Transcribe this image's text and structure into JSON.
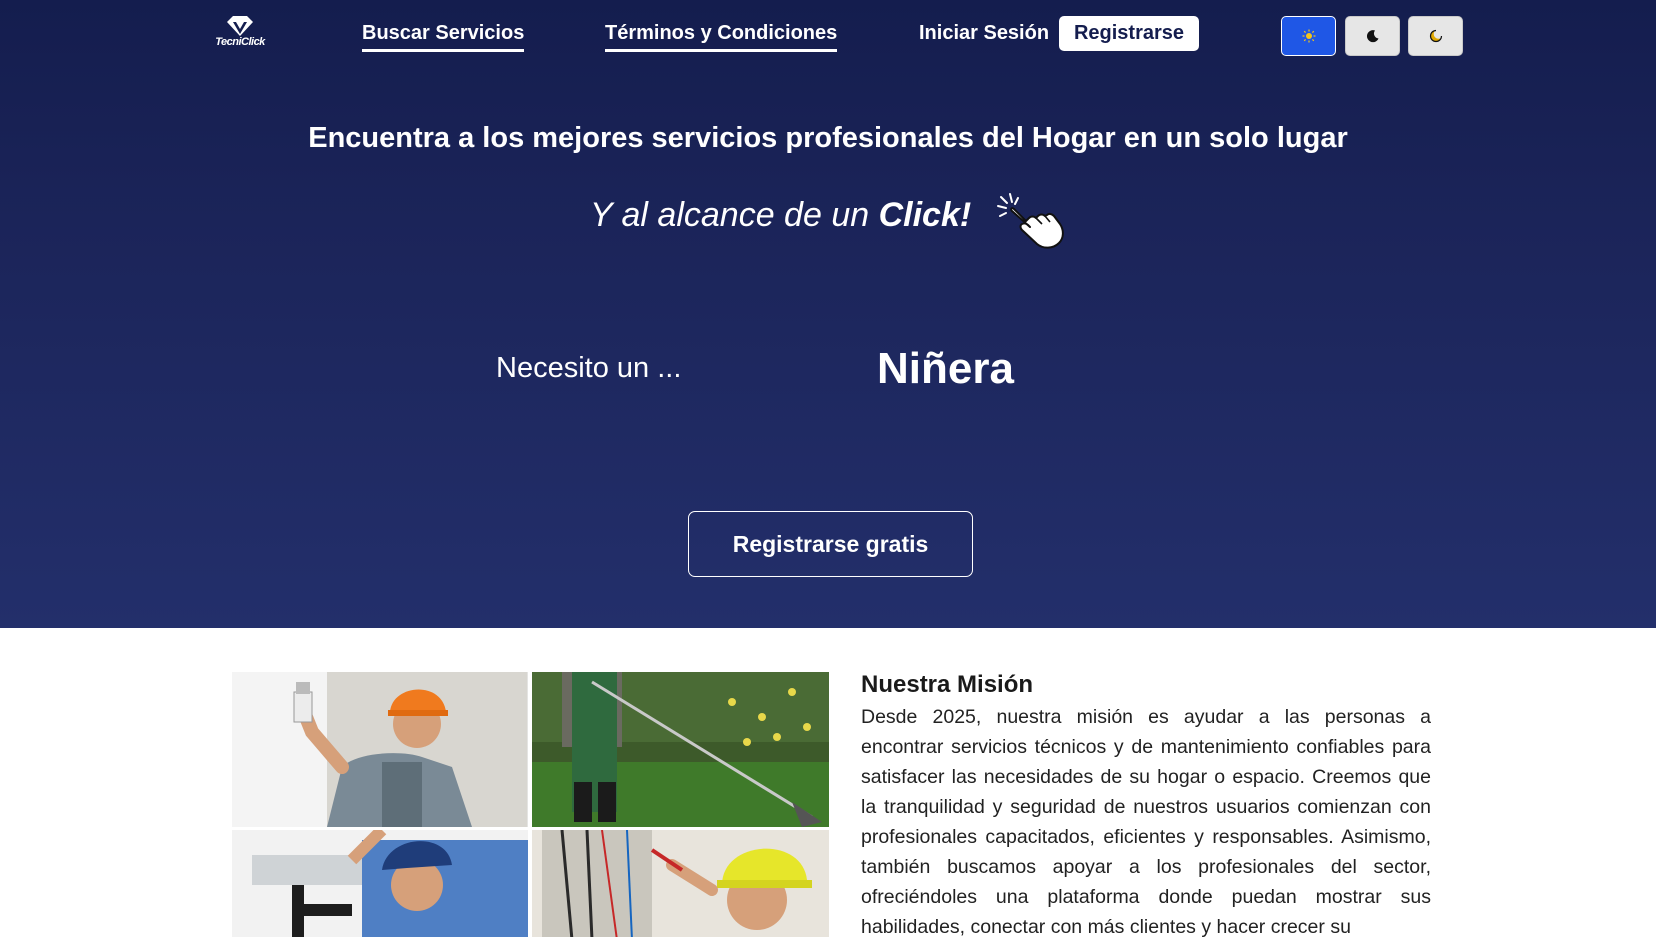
{
  "nav": {
    "logo_text": "TecniClick",
    "links": {
      "buscar": "Buscar Servicios",
      "terminos": "Términos y Condiciones",
      "login": "Iniciar Sesión"
    },
    "register_label": "Registrarse",
    "theme_buttons": [
      {
        "icon": "sun-icon",
        "active": true
      },
      {
        "icon": "moon-icon",
        "active": false
      },
      {
        "icon": "crescent-icon",
        "active": false
      }
    ]
  },
  "hero": {
    "headline": "Encuentra a los mejores servicios profesionales del Hogar en un solo lugar",
    "tagline_prefix": "Y al alcance de un ",
    "tagline_emphasis": "Click!",
    "need_label": "Necesito un ...",
    "need_value": "Niñera",
    "cta_label": "Registrarse gratis"
  },
  "mission": {
    "title": "Nuestra Misión",
    "text": "Desde 2025, nuestra misión es ayudar a las personas a encontrar servicios técnicos y de mantenimiento confiables para satisfacer las necesidades de su hogar o espacio. Creemos que la tranquilidad y seguridad de nuestros usuarios comienzan con profesionales capacitados, eficientes y responsables. Asimismo, también buscamos apoyar a los profesionales del sector, ofreciéndoles una plataforma donde puedan mostrar sus habilidades, conectar con más clientes y hacer crecer su"
  },
  "colors": {
    "hero_bg_top": "#141d4e",
    "hero_bg_bottom": "#232f6b",
    "theme_active": "#1f57e6"
  }
}
